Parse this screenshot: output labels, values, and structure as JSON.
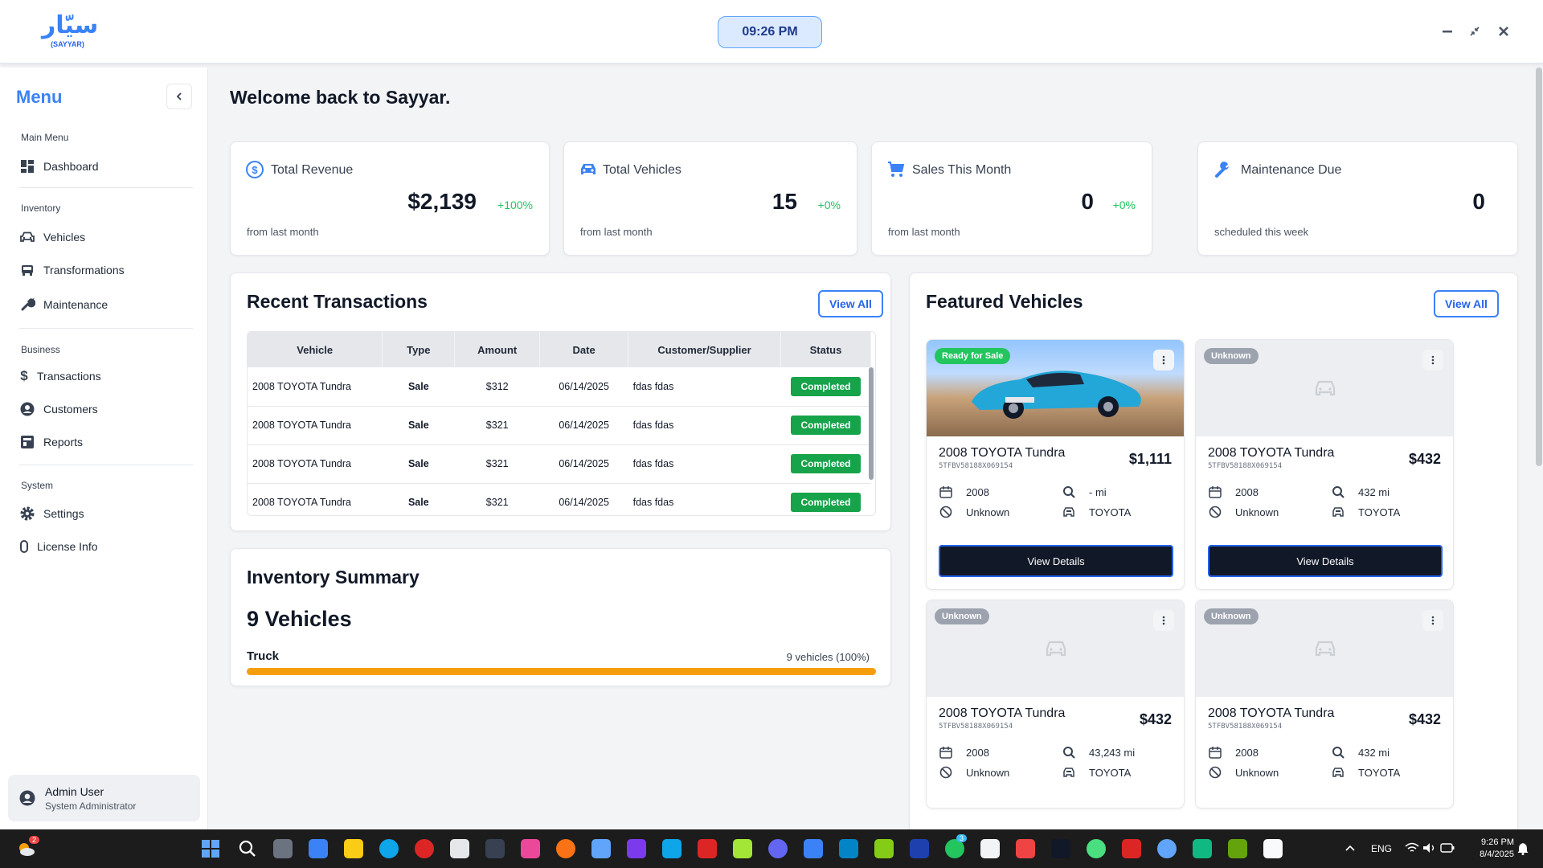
{
  "app": {
    "logo_ar": "سيّار",
    "logo_en": "(SAYYAR)",
    "clock": "09:26 PM"
  },
  "sidebar": {
    "title": "Menu",
    "sections": [
      {
        "label": "Main Menu",
        "items": [
          {
            "label": "Dashboard",
            "icon": "dashboard-icon"
          }
        ]
      },
      {
        "label": "Inventory",
        "items": [
          {
            "label": "Vehicles",
            "icon": "car-icon"
          },
          {
            "label": "Transformations",
            "icon": "bus-icon"
          },
          {
            "label": "Maintenance",
            "icon": "wrench-icon"
          }
        ]
      },
      {
        "label": "Business",
        "items": [
          {
            "label": "Transactions",
            "icon": "dollar-icon"
          },
          {
            "label": "Customers",
            "icon": "user-circle-icon"
          },
          {
            "label": "Reports",
            "icon": "report-icon"
          }
        ]
      },
      {
        "label": "System",
        "items": [
          {
            "label": "Settings",
            "icon": "gear-icon"
          },
          {
            "label": "License Info",
            "icon": "license-icon"
          }
        ]
      }
    ],
    "user": {
      "name": "Admin User",
      "role": "System Administrator"
    }
  },
  "main": {
    "welcome": "Welcome back to Sayyar.",
    "stats": [
      {
        "label": "Total Revenue",
        "value": "$2,139",
        "change": "+100%",
        "sub": "from last month",
        "icon": "dollar-circle-icon"
      },
      {
        "label": "Total Vehicles",
        "value": "15",
        "change": "+0%",
        "sub": "from last month",
        "icon": "car-icon"
      },
      {
        "label": "Sales This Month",
        "value": "0",
        "change": "+0%",
        "sub": "from last month",
        "icon": "cart-icon"
      },
      {
        "label": "Maintenance Due",
        "value": "0",
        "change": "",
        "sub": "scheduled this week",
        "icon": "wrench-icon"
      }
    ],
    "transactions": {
      "title": "Recent Transactions",
      "view_all": "View All",
      "columns": [
        "Vehicle",
        "Type",
        "Amount",
        "Date",
        "Customer/Supplier",
        "Status"
      ],
      "rows": [
        [
          "2008 TOYOTA Tundra",
          "Sale",
          "$312",
          "06/14/2025",
          "fdas fdas",
          "Completed"
        ],
        [
          "2008 TOYOTA Tundra",
          "Sale",
          "$321",
          "06/14/2025",
          "fdas fdas",
          "Completed"
        ],
        [
          "2008 TOYOTA Tundra",
          "Sale",
          "$321",
          "06/14/2025",
          "fdas fdas",
          "Completed"
        ],
        [
          "2008 TOYOTA Tundra",
          "Sale",
          "$321",
          "06/14/2025",
          "fdas fdas",
          "Completed"
        ]
      ]
    },
    "inventory": {
      "title": "Inventory Summary",
      "count": "9 Vehicles",
      "category": "Truck",
      "category_info": "9 vehicles (100%)",
      "fill": 1.0,
      "bar_color": "#f59e0b"
    },
    "featured": {
      "title": "Featured Vehicles",
      "view_all": "View All",
      "details_label": "View Details",
      "vehicles": [
        {
          "badge": "Ready for Sale",
          "badge_color": "#22c55e",
          "title": "2008 TOYOTA Tundra",
          "vin": "5TFBV58188X069154",
          "price": "$1,111",
          "year": "2008",
          "mileage": "- mi",
          "condition": "Unknown",
          "make": "TOYOTA",
          "has_photo": true
        },
        {
          "badge": "Unknown",
          "badge_color": "#9ca3af",
          "title": "2008 TOYOTA Tundra",
          "vin": "5TFBV58188X069154",
          "price": "$432",
          "year": "2008",
          "mileage": "432 mi",
          "condition": "Unknown",
          "make": "TOYOTA",
          "has_photo": false
        },
        {
          "badge": "Unknown",
          "badge_color": "#9ca3af",
          "title": "2008 TOYOTA Tundra",
          "vin": "5TFBV58188X069154",
          "price": "$432",
          "year": "2008",
          "mileage": "43,243 mi",
          "condition": "Unknown",
          "make": "TOYOTA",
          "has_photo": false
        },
        {
          "badge": "Unknown",
          "badge_color": "#9ca3af",
          "title": "2008 TOYOTA Tundra",
          "vin": "5TFBV58188X069154",
          "price": "$432",
          "year": "2008",
          "mileage": "432 mi",
          "condition": "Unknown",
          "make": "TOYOTA",
          "has_photo": false
        }
      ]
    }
  },
  "taskbar": {
    "lang": "ENG",
    "time": "9:26 PM",
    "date": "8/4/2025",
    "weather_badge": "2",
    "whatsapp_badge": "3"
  },
  "colors": {
    "accent": "#3b82f6",
    "success": "#16a34a",
    "dark_button": "#111827"
  }
}
